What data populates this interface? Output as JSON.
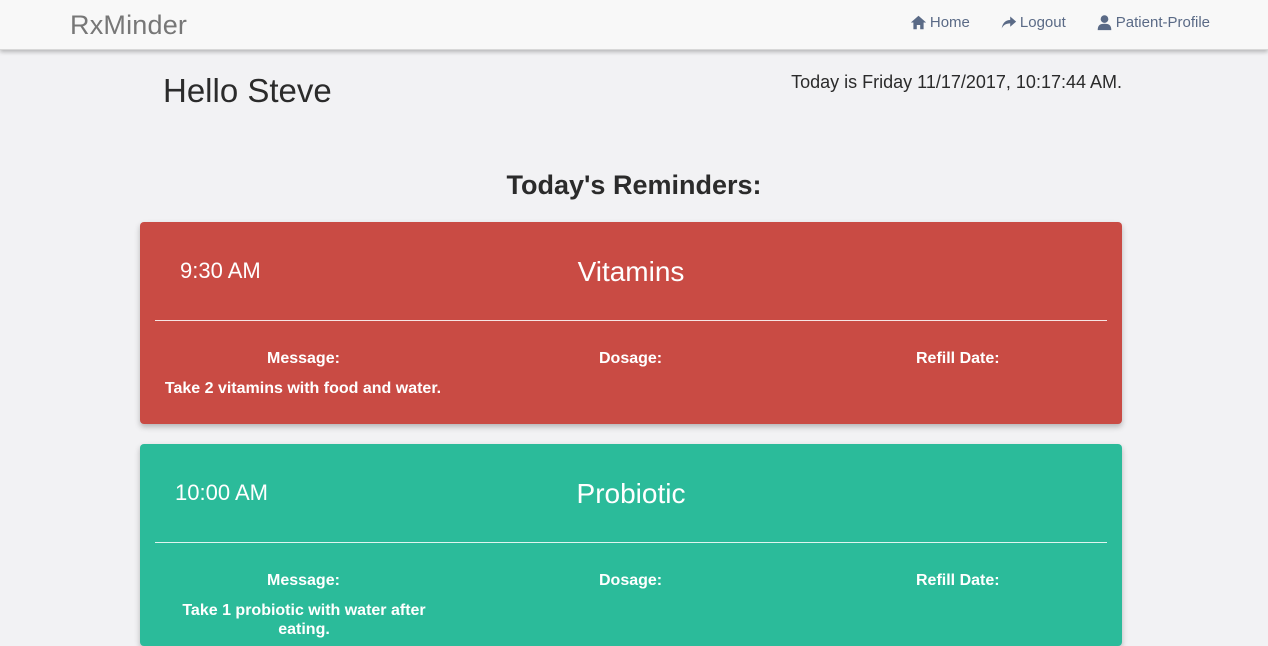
{
  "app": {
    "brand": "RxMinder"
  },
  "nav": {
    "items": [
      {
        "label": "Home",
        "icon": "home-icon"
      },
      {
        "label": "Logout",
        "icon": "share-arrow-icon"
      },
      {
        "label": "Patient-Profile",
        "icon": "user-icon"
      }
    ]
  },
  "header": {
    "greeting": "Hello Steve",
    "today": "Today is Friday 11/17/2017, 10:17:44 AM."
  },
  "reminders": {
    "title": "Today's Reminders:",
    "items": [
      {
        "time": "9:30 AM",
        "name": "Vitamins",
        "message_label": "Message:",
        "message": "Take 2 vitamins with food and water.",
        "dosage_label": "Dosage:",
        "dosage": "",
        "refill_label": "Refill Date:",
        "refill": "",
        "color": "#c94b44"
      },
      {
        "time": "10:00 AM",
        "name": "Probiotic",
        "message_label": "Message:",
        "message": "Take 1 probiotic with water after eating.",
        "dosage_label": "Dosage:",
        "dosage": "",
        "refill_label": "Refill Date:",
        "refill": "",
        "color": "#2bbb9a"
      }
    ]
  }
}
